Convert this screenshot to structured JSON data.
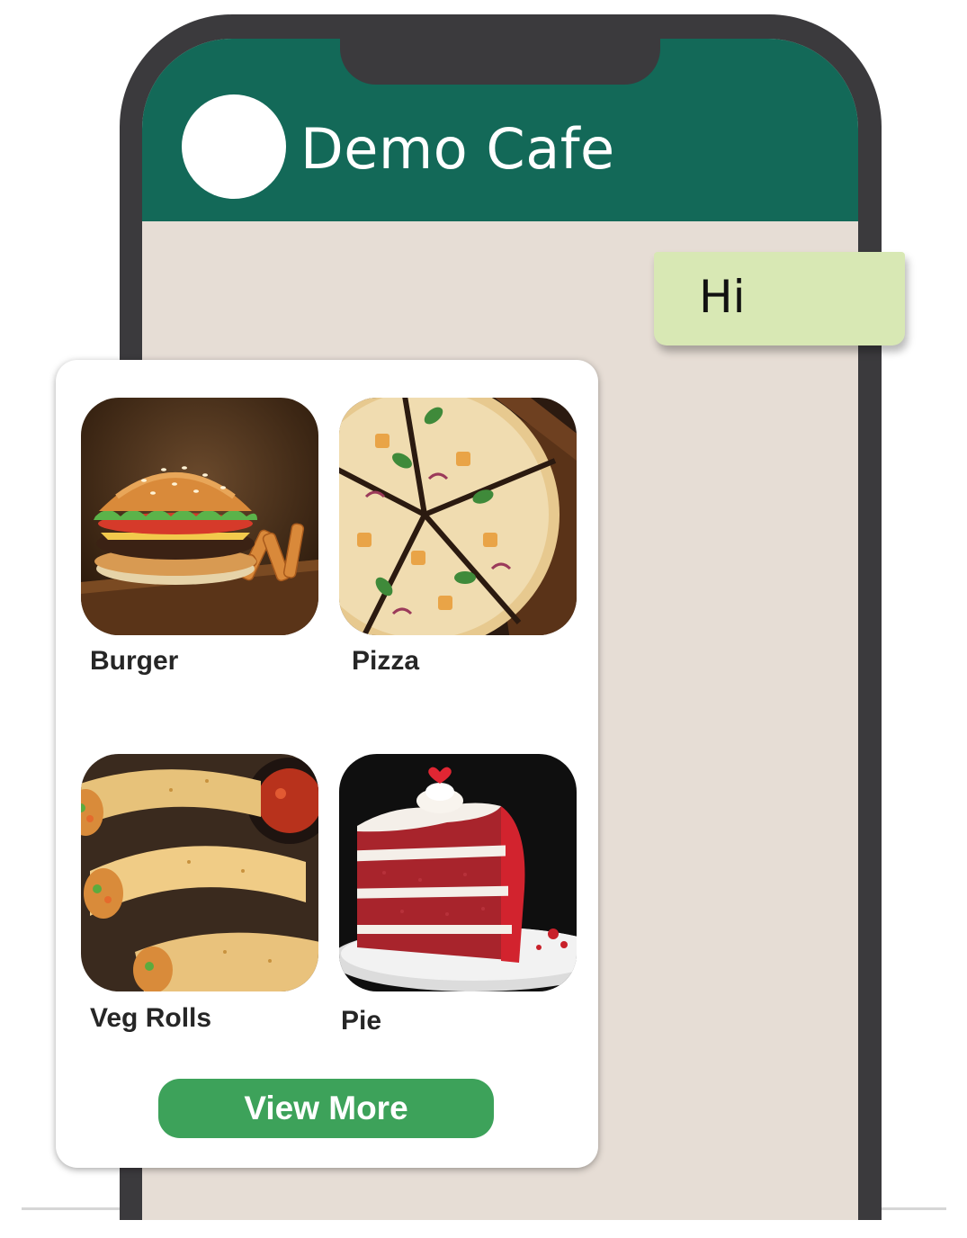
{
  "header": {
    "title": "Demo Cafe"
  },
  "messages": [
    {
      "direction": "sent",
      "text": "Hi"
    }
  ],
  "menu": {
    "items": [
      {
        "label": "Burger",
        "icon": "burger-photo"
      },
      {
        "label": "Pizza",
        "icon": "pizza-photo"
      },
      {
        "label": "Veg Rolls",
        "icon": "veg-rolls-photo"
      },
      {
        "label": "Pie",
        "icon": "pie-photo"
      }
    ],
    "button_label": "View More"
  },
  "colors": {
    "header": "#136958",
    "chat_background": "#e6ddd5",
    "sent_bubble": "#d8e8b4",
    "button": "#3da25a",
    "phone_frame": "#3b3a3d"
  }
}
